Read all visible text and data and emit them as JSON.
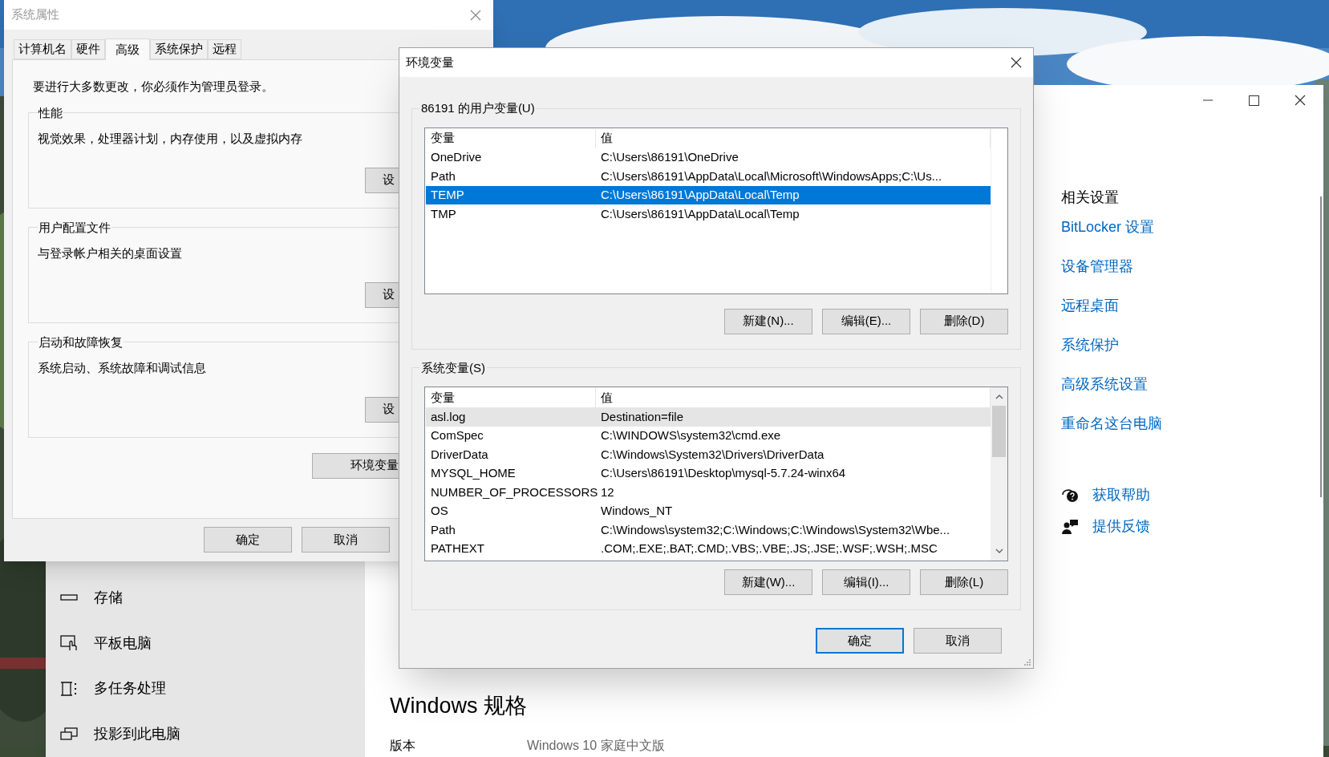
{
  "system_properties": {
    "title": "系统属性",
    "active": false,
    "tabs": [
      {
        "label": "计算机名",
        "selected": false
      },
      {
        "label": "硬件",
        "selected": false
      },
      {
        "label": "高级",
        "selected": true
      },
      {
        "label": "系统保护",
        "selected": false
      },
      {
        "label": "远程",
        "selected": false
      }
    ],
    "notice": "要进行大多数更改，你必须作为管理员登录。",
    "groups": [
      {
        "title": "性能",
        "description": "视觉效果，处理器计划，内存使用，以及虚拟内存",
        "button": "设"
      },
      {
        "title": "用户配置文件",
        "description": "与登录帐户相关的桌面设置",
        "button": "设"
      },
      {
        "title": "启动和故障恢复",
        "description": "系统启动、系统故障和调试信息",
        "button": "设"
      }
    ],
    "env_button": "环境变量",
    "buttons": [
      {
        "label": "确定",
        "default": false
      },
      {
        "label": "取消",
        "default": false
      }
    ]
  },
  "env_dialog": {
    "title": "环境变量",
    "active": true,
    "user_vars": {
      "title": "86191 的用户变量(U)",
      "focused": true,
      "columns": [
        "变量",
        "值"
      ],
      "rows": [
        {
          "name": "OneDrive",
          "value": "C:\\Users\\86191\\OneDrive",
          "selected": false
        },
        {
          "name": "Path",
          "value": "C:\\Users\\86191\\AppData\\Local\\Microsoft\\WindowsApps;C:\\Us...",
          "selected": false
        },
        {
          "name": "TEMP",
          "value": "C:\\Users\\86191\\AppData\\Local\\Temp",
          "selected": true
        },
        {
          "name": "TMP",
          "value": "C:\\Users\\86191\\AppData\\Local\\Temp",
          "selected": false
        }
      ],
      "buttons": [
        "新建(N)...",
        "编辑(E)...",
        "删除(D)"
      ]
    },
    "system_vars": {
      "title": "系统变量(S)",
      "focused": false,
      "columns": [
        "变量",
        "值"
      ],
      "rows": [
        {
          "name": "asl.log",
          "value": "Destination=file",
          "selected": true
        },
        {
          "name": "ComSpec",
          "value": "C:\\WINDOWS\\system32\\cmd.exe",
          "selected": false
        },
        {
          "name": "DriverData",
          "value": "C:\\Windows\\System32\\Drivers\\DriverData",
          "selected": false
        },
        {
          "name": "MYSQL_HOME",
          "value": "C:\\Users\\86191\\Desktop\\mysql-5.7.24-winx64",
          "selected": false
        },
        {
          "name": "NUMBER_OF_PROCESSORS",
          "value": "12",
          "selected": false
        },
        {
          "name": "OS",
          "value": "Windows_NT",
          "selected": false
        },
        {
          "name": "Path",
          "value": "C:\\Windows\\system32;C:\\Windows;C:\\Windows\\System32\\Wbe...",
          "selected": false
        },
        {
          "name": "PATHEXT",
          "value": ".COM;.EXE;.BAT;.CMD;.VBS;.VBE;.JS;.JSE;.WSF;.WSH;.MSC",
          "selected": false
        }
      ],
      "buttons": [
        "新建(W)...",
        "编辑(I)...",
        "删除(L)"
      ]
    },
    "buttons": [
      {
        "label": "确定",
        "default": true
      },
      {
        "label": "取消",
        "default": false
      }
    ]
  },
  "settings": {
    "sidebar": [
      {
        "label": "存储"
      },
      {
        "label": "平板电脑"
      },
      {
        "label": "多任务处理"
      },
      {
        "label": "投影到此电脑"
      }
    ],
    "spec_title": "Windows 规格",
    "spec_rows": [
      {
        "label": "版本",
        "value": "Windows 10 家庭中文版"
      }
    ],
    "related_title": "相关设置",
    "related_links": [
      "BitLocker 设置",
      "设备管理器",
      "远程桌面",
      "系统保护",
      "高级系统设置",
      "重命名这台电脑"
    ],
    "help_links": [
      "获取帮助",
      "提供反馈"
    ]
  }
}
